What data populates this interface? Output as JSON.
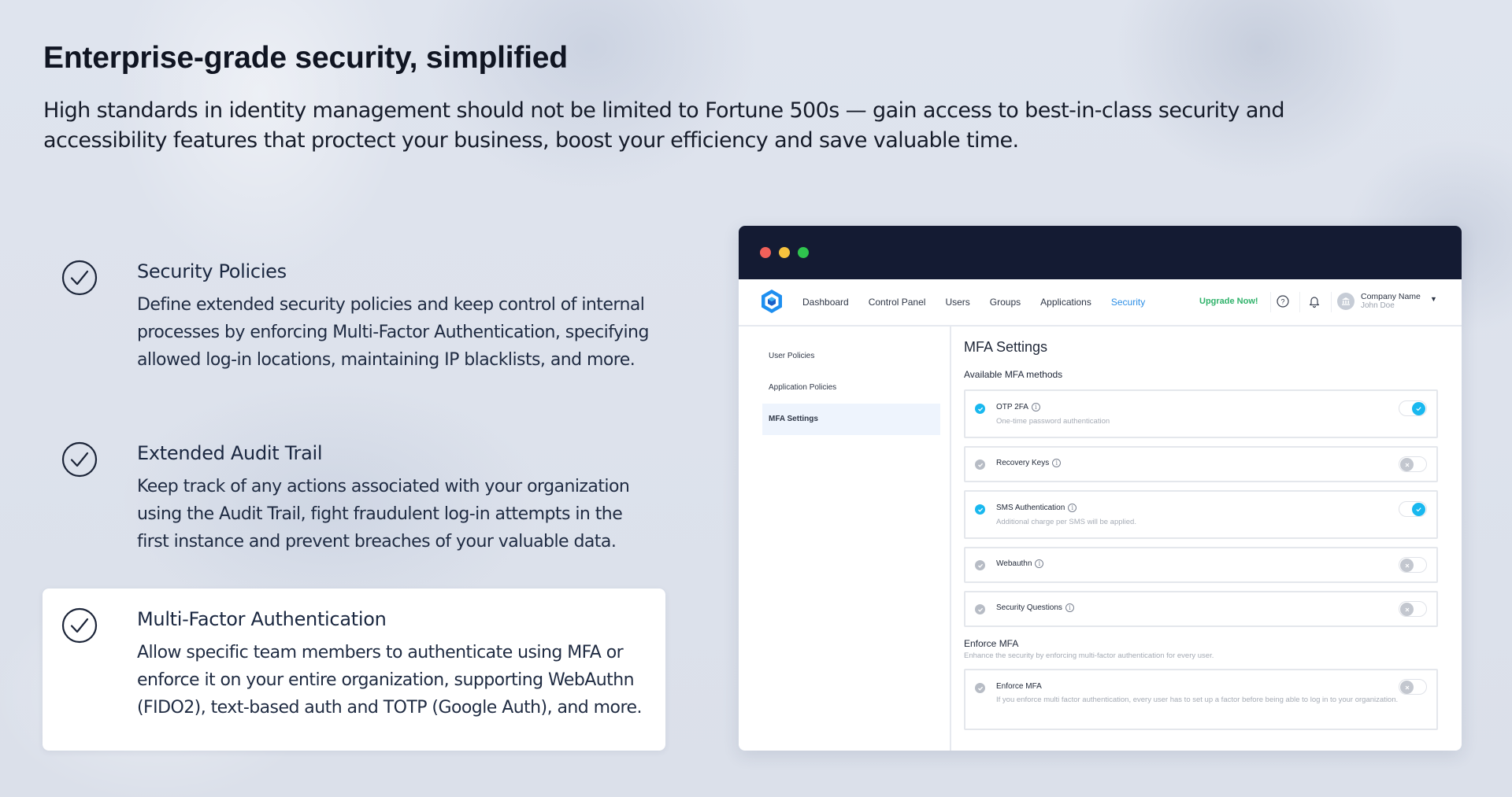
{
  "hero": {
    "title": "Enterprise-grade security, simplified",
    "subtitle": "High standards in identity management should not be limited to Fortune 500s — gain access to best-in-class security and accessibility features that proctect your business, boost your efficiency and save valuable time."
  },
  "features": [
    {
      "title": "Security Policies",
      "body": "Define extended security policies and keep control of internal processes by enforcing Multi-Factor Authentication, specifying allowed log-in locations, maintaining IP blacklists, and more.",
      "icon": "check-circle-icon",
      "active": false
    },
    {
      "title": "Extended Audit Trail",
      "body": "Keep track of any actions associated with your organization using the Audit Trail, fight fraudulent log-in attempts in the first instance and prevent breaches of your valuable data.",
      "icon": "check-circle-icon",
      "active": false
    },
    {
      "title": "Multi-Factor Authentication",
      "body": "Allow specific team members to authenticate using MFA or enforce it on your entire organization, supporting WebAuthn (FIDO2), text-based auth and TOTP (Google Auth), and more.",
      "icon": "check-circle-icon",
      "active": true
    }
  ],
  "app": {
    "nav": {
      "items": [
        "Dashboard",
        "Control Panel",
        "Users",
        "Groups",
        "Applications",
        "Security"
      ],
      "active": "Security",
      "upgrade_label": "Upgrade Now!",
      "company_name": "Company Name",
      "user_name": "John Doe"
    },
    "sidebar": {
      "items": [
        "User Policies",
        "Application Policies",
        "MFA Settings"
      ],
      "active": "MFA Settings"
    },
    "main": {
      "title": "MFA Settings",
      "methods_heading": "Available MFA methods",
      "methods": [
        {
          "name": "OTP 2FA",
          "description": "One-time password authentication",
          "enabled": true
        },
        {
          "name": "Recovery Keys",
          "description": "",
          "enabled": false
        },
        {
          "name": "SMS Authentication",
          "description": "Additional charge per SMS will be applied.",
          "enabled": true
        },
        {
          "name": "Webauthn",
          "description": "",
          "enabled": false
        },
        {
          "name": "Security Questions",
          "description": "",
          "enabled": false
        }
      ],
      "enforce": {
        "heading": "Enforce MFA",
        "description": "Enhance the security by enforcing multi-factor authentication for every user.",
        "item_name": "Enforce MFA",
        "item_description": "If you enforce multi factor authentication, every user has to set up a factor before being able to log in to your organization.",
        "enabled": false
      }
    },
    "colors": {
      "accent": "#19b8ef",
      "link": "#2d8fe6",
      "upgrade": "#2fb26a",
      "titlebar": "#141b33"
    }
  }
}
